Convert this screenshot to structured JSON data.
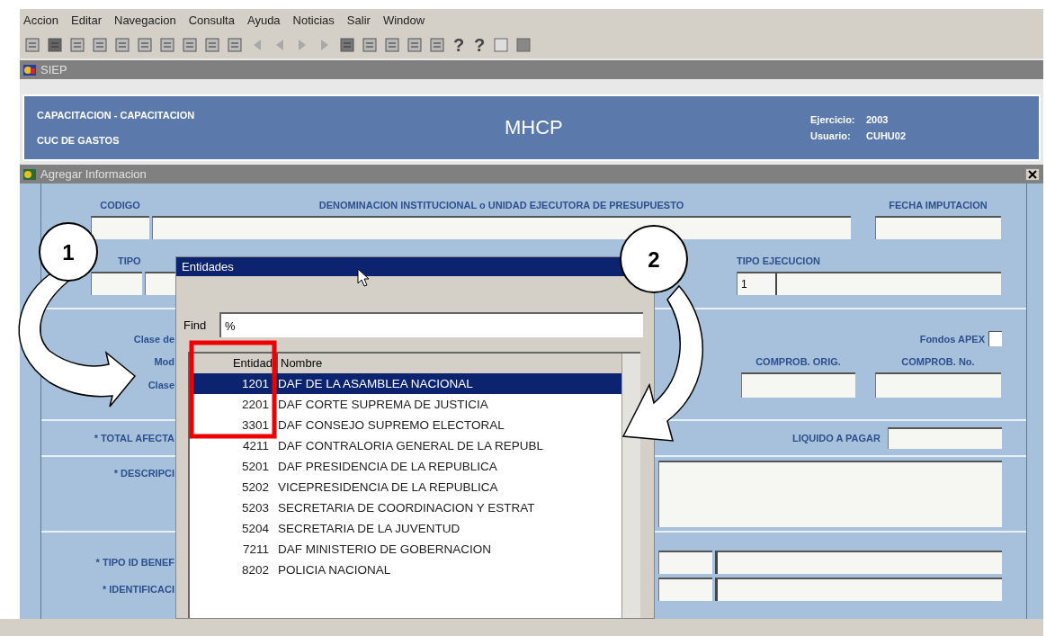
{
  "menu": [
    {
      "label": "Accion"
    },
    {
      "label": "Editar"
    },
    {
      "label": "Navegacion"
    },
    {
      "label": "Consulta"
    },
    {
      "label": "Ayuda"
    },
    {
      "label": "Noticias"
    },
    {
      "label": "Salir"
    },
    {
      "label": "Window"
    }
  ],
  "toolbar_help": [
    "?",
    "?"
  ],
  "app_window": {
    "title": "SIEP"
  },
  "header": {
    "line1": "CAPACITACION - CAPACITACION",
    "line2": "CUC DE GASTOS",
    "center": "MHCP",
    "fields": [
      {
        "label": "Ejercicio:",
        "value": "2003"
      },
      {
        "label": "Usuario:",
        "value": "CUHU02"
      }
    ]
  },
  "form_window": {
    "title": "Agregar Informacion"
  },
  "form": {
    "codigo_label": "CODIGO",
    "denominacion_label": "DENOMINACION INSTITUCIONAL o UNIDAD EJECUTORA DE PRESUPUESTO",
    "fecha_label": "FECHA IMPUTACION",
    "tipo_label": "TIPO",
    "tipo_ejecucion_label": "TIPO EJECUCION",
    "tipo_ejecucion_code": "1",
    "clase_label": "Clase de",
    "mod_label": "Mod",
    "clase2_label": "Clase",
    "fondos_apex": {
      "label": "Fondos APEX",
      "checked": false
    },
    "comprob_orig_label": "COMPROB. ORIG.",
    "comprob_no_label": "COMPROB. No.",
    "total_label": "* TOTAL AFECTA",
    "liquido_label": "LIQUIDO A PAGAR",
    "descripcion_label": "* DESCRIPCI",
    "tipo_id_label": "* TIPO ID BENEF",
    "identificacion_label": "* IDENTIFICACI"
  },
  "lov": {
    "title": "Entidades",
    "find_label": "Find",
    "find_value": "%",
    "columns": [
      "Entidad",
      "Nombre"
    ],
    "rows": [
      {
        "code": "1201",
        "name": "DAF DE LA ASAMBLEA NACIONAL",
        "selected": true
      },
      {
        "code": "2201",
        "name": "DAF CORTE SUPREMA DE JUSTICIA",
        "selected": false
      },
      {
        "code": "3301",
        "name": "DAF CONSEJO SUPREMO ELECTORAL",
        "selected": false
      },
      {
        "code": "4211",
        "name": "DAF CONTRALORIA GENERAL DE LA REPUBL",
        "selected": false
      },
      {
        "code": "5201",
        "name": "DAF PRESIDENCIA DE LA REPUBLICA",
        "selected": false
      },
      {
        "code": "5202",
        "name": "VICEPRESIDENCIA DE LA REPUBLICA",
        "selected": false
      },
      {
        "code": "5203",
        "name": "SECRETARIA DE COORDINACION Y ESTRAT",
        "selected": false
      },
      {
        "code": "5204",
        "name": "SECRETARIA DE LA JUVENTUD",
        "selected": false
      },
      {
        "code": "7211",
        "name": "DAF MINISTERIO DE GOBERNACION",
        "selected": false
      },
      {
        "code": "8202",
        "name": "POLICIA NACIONAL",
        "selected": false
      }
    ]
  },
  "annotations": [
    {
      "number": "1"
    },
    {
      "number": "2"
    }
  ]
}
